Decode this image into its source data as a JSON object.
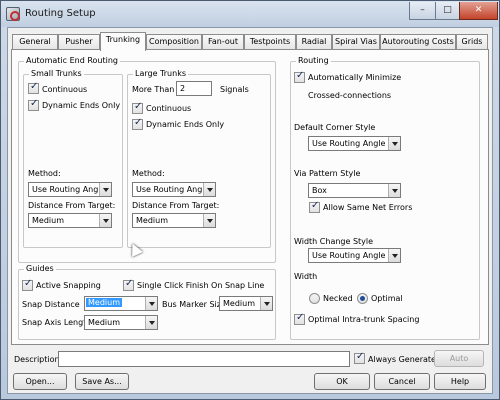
{
  "window": {
    "title": "Routing Setup",
    "minimize": "–",
    "maximize": "□",
    "close": "✕"
  },
  "tabs": [
    "General",
    "Pusher",
    "Trunking",
    "Composition",
    "Fan-out",
    "Testpoints",
    "Radial",
    "Spiral Vias",
    "Autorouting Costs",
    "Grids"
  ],
  "active_tab": "Trunking",
  "aer": {
    "title": "Automatic End Routing",
    "small": {
      "title": "Small Trunks",
      "continuous": {
        "label": "Continuous",
        "checked": true
      },
      "dynamic_ends_only": {
        "label": "Dynamic Ends Only",
        "checked": true
      },
      "method_label": "Method:",
      "method_value": "Use Routing Angle",
      "distance_label": "Distance From Target:",
      "distance_value": "Medium"
    },
    "large": {
      "title": "Large Trunks",
      "more_than_label": "More Than",
      "more_than_value": "2",
      "signals_label": "Signals",
      "continuous": {
        "label": "Continuous",
        "checked": true
      },
      "dynamic_ends_only": {
        "label": "Dynamic Ends Only",
        "checked": true
      },
      "method_label": "Method:",
      "method_value": "Use Routing Angle",
      "distance_label": "Distance From Target:",
      "distance_value": "Medium"
    }
  },
  "guides": {
    "title": "Guides",
    "active_snapping": {
      "label": "Active Snapping",
      "checked": true
    },
    "single_click": {
      "label": "Single Click Finish On Snap Line",
      "checked": true
    },
    "snap_distance_label": "Snap Distance",
    "snap_distance_value": "Medium",
    "bus_marker_label": "Bus Marker Size",
    "bus_marker_value": "Medium",
    "snap_axis_label": "Snap Axis Length",
    "snap_axis_value": "Medium"
  },
  "routing": {
    "title": "Routing",
    "auto_min": {
      "label": "Automatically Minimize",
      "checked": true
    },
    "crossed_label": "Crossed-connections",
    "corner_label": "Default Corner Style",
    "corner_value": "Use Routing Angle",
    "via_label": "Via Pattern Style",
    "via_value": "Box",
    "allow_same_net": {
      "label": "Allow Same Net Errors",
      "checked": true
    },
    "width_change_label": "Width Change Style",
    "width_change_value": "Use Routing Angle",
    "width_label": "Width",
    "necked": {
      "label": "Necked",
      "checked": false
    },
    "optimal": {
      "label": "Optimal",
      "checked": true
    },
    "intra_trunk": {
      "label": "Optimal Intra-trunk Spacing",
      "checked": true
    }
  },
  "footer": {
    "description_label": "Description:",
    "description_value": "",
    "always_generate": {
      "label": "Always Generate",
      "checked": true
    },
    "auto_label": "Auto",
    "open_label": "Open...",
    "save_as_label": "Save As...",
    "ok_label": "OK",
    "cancel_label": "Cancel",
    "help_label": "Help"
  }
}
